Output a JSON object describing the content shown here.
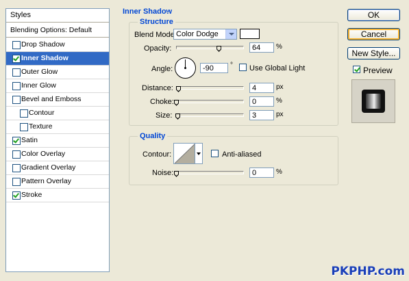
{
  "styles_panel": {
    "title": "Styles",
    "blending_options": "Blending Options: Default",
    "items": [
      {
        "label": "Drop Shadow",
        "checked": false,
        "selected": false,
        "indent": 0
      },
      {
        "label": "Inner Shadow",
        "checked": true,
        "selected": true,
        "indent": 0
      },
      {
        "label": "Outer Glow",
        "checked": false,
        "selected": false,
        "indent": 0
      },
      {
        "label": "Inner Glow",
        "checked": false,
        "selected": false,
        "indent": 0
      },
      {
        "label": "Bevel and Emboss",
        "checked": false,
        "selected": false,
        "indent": 0
      },
      {
        "label": "Contour",
        "checked": false,
        "selected": false,
        "indent": 1
      },
      {
        "label": "Texture",
        "checked": false,
        "selected": false,
        "indent": 1
      },
      {
        "label": "Satin",
        "checked": true,
        "selected": false,
        "indent": 0
      },
      {
        "label": "Color Overlay",
        "checked": false,
        "selected": false,
        "indent": 0
      },
      {
        "label": "Gradient Overlay",
        "checked": false,
        "selected": false,
        "indent": 0
      },
      {
        "label": "Pattern Overlay",
        "checked": false,
        "selected": false,
        "indent": 0
      },
      {
        "label": "Stroke",
        "checked": true,
        "selected": false,
        "indent": 0
      }
    ]
  },
  "inner_shadow": {
    "title": "Inner Shadow",
    "structure": {
      "title": "Structure",
      "blend_mode_label": "Blend Mode:",
      "blend_mode_value": "Color Dodge",
      "blend_color": "#ffffff",
      "opacity_label": "Opacity:",
      "opacity_value": "64",
      "opacity_unit": "%",
      "opacity_fraction": 0.64,
      "angle_label": "Angle:",
      "angle_value": "-90",
      "angle_unit": "°",
      "use_global_light_label": "Use Global Light",
      "use_global_light_checked": false,
      "distance_label": "Distance:",
      "distance_value": "4",
      "distance_unit": "px",
      "choke_label": "Choke:",
      "choke_value": "0",
      "choke_unit": "%",
      "size_label": "Size:",
      "size_value": "3",
      "size_unit": "px"
    },
    "quality": {
      "title": "Quality",
      "contour_label": "Contour:",
      "anti_aliased_label": "Anti-aliased",
      "anti_aliased_checked": false,
      "noise_label": "Noise:",
      "noise_value": "0",
      "noise_unit": "%"
    }
  },
  "buttons": {
    "ok": "OK",
    "cancel": "Cancel",
    "new_style": "New Style...",
    "preview_label": "Preview",
    "preview_checked": true
  },
  "watermark": "PKPHP.com",
  "colors": {
    "dialog_bg": "#ece9d8",
    "accent": "#0046d5",
    "selection": "#316ac5"
  }
}
